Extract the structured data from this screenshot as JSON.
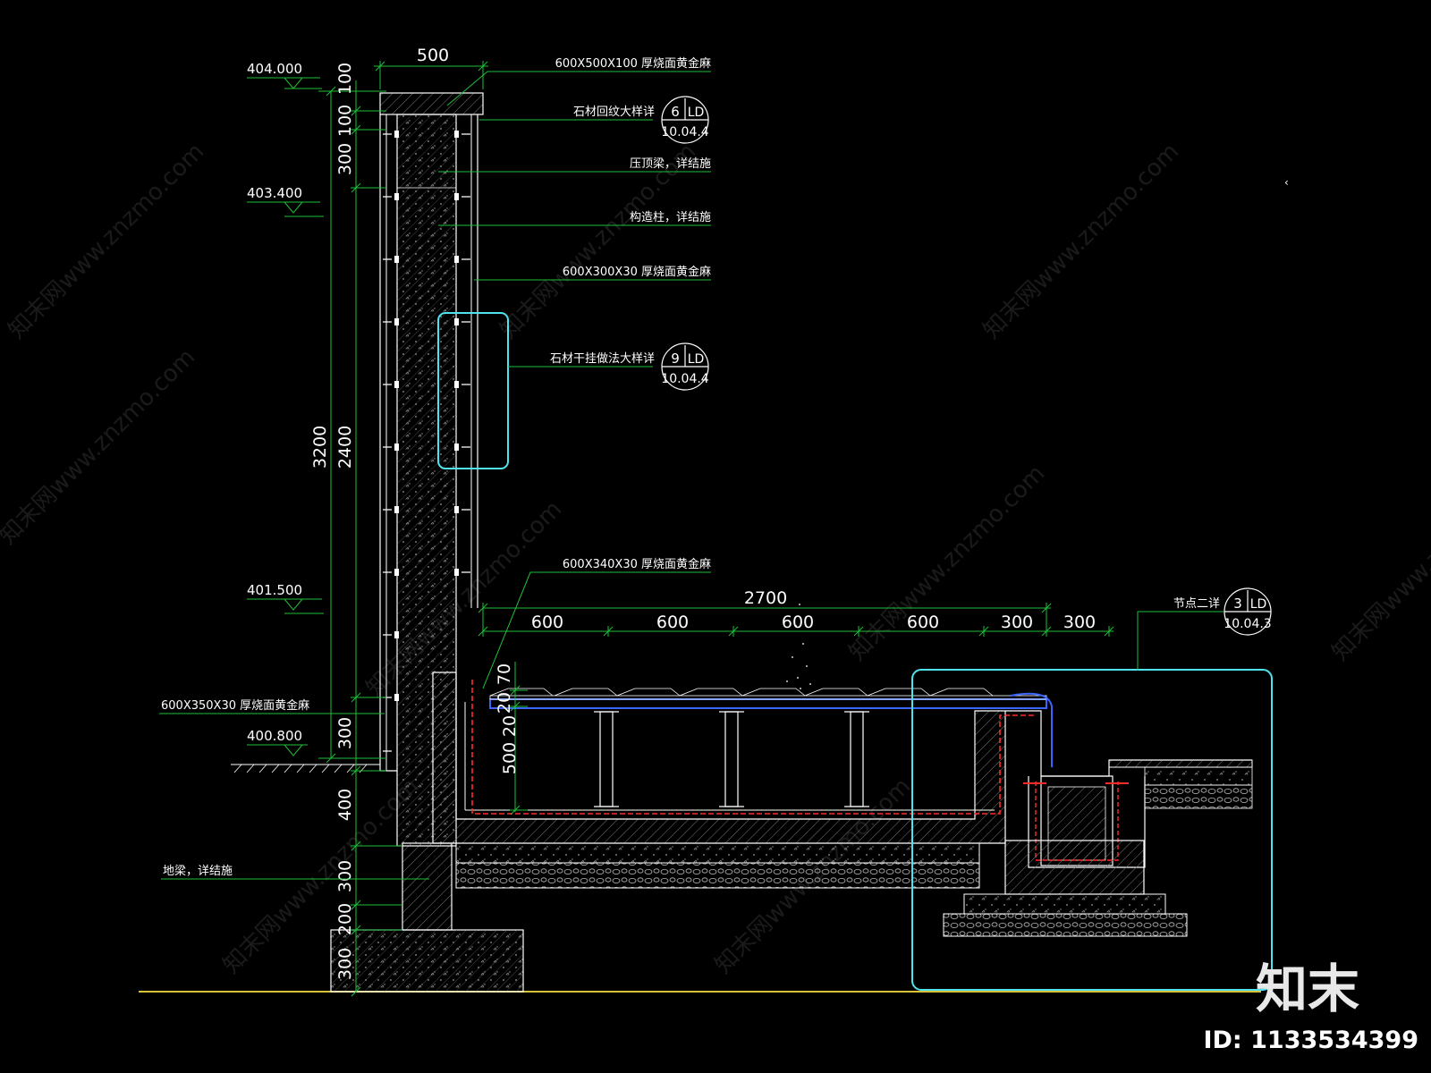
{
  "colors": {
    "background": "#000000",
    "line_white": "#ffffff",
    "line_green": "#1fbf3a",
    "line_cyan": "#4fe3ee",
    "line_red": "#ff2a2a",
    "line_blue": "#3a66ff",
    "ground_yellow": "#d8c23a",
    "hatch_grey": "#8a8a8a"
  },
  "watermark": {
    "text": "知末网www.znzmo.com",
    "logo": "知末",
    "id": "ID: 1133534399"
  },
  "levels": [
    "404.000",
    "403.400",
    "401.500",
    "400.800"
  ],
  "vertical_dims_left": {
    "overall": "3200",
    "upper": [
      "100",
      "100",
      "300"
    ],
    "middle": "2400",
    "lower": [
      "300",
      "400",
      "300",
      "200",
      "300"
    ]
  },
  "top_dim": "500",
  "callouts": {
    "cap_stone": "600X500X100 厚烧面黄金麻",
    "pattern_detail": "石材回纹大样详",
    "top_beam": "压顶梁，详结施",
    "column": "构造柱，详结施",
    "wall_cladding": "600X300X30 厚烧面黄金麻",
    "dry_hang_detail": "石材干挂做法大样详",
    "pool_paving": "600X340X30 厚烧面黄金麻",
    "base_cladding": "600X350X30 厚烧面黄金麻",
    "ground_beam": "地梁，详结施",
    "node_detail": "节点二详"
  },
  "detail_bubbles": [
    {
      "num": "6",
      "tag": "LD",
      "sheet": "10.04.4"
    },
    {
      "num": "9",
      "tag": "LD",
      "sheet": "10.04.4"
    },
    {
      "num": "3",
      "tag": "LD",
      "sheet": "10.04.3"
    }
  ],
  "horizontal_dims": {
    "overall": "2700",
    "segments": [
      "600",
      "600",
      "600",
      "600",
      "300",
      "300"
    ]
  },
  "pool_dims": {
    "upper": [
      "20",
      "70"
    ],
    "side": [
      "20",
      "500"
    ]
  }
}
